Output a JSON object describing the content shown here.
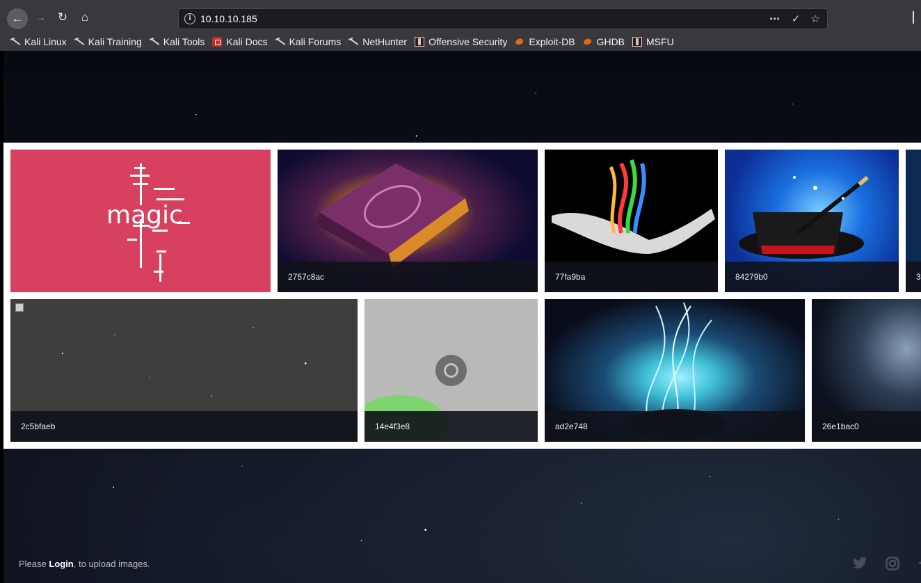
{
  "browser": {
    "url": "10.10.10.185",
    "bookmarks": [
      {
        "label": "Kali Linux",
        "icon": "kali-dragon-icon"
      },
      {
        "label": "Kali Training",
        "icon": "kali-dragon-icon"
      },
      {
        "label": "Kali Tools",
        "icon": "kali-dragon-icon"
      },
      {
        "label": "Kali Docs",
        "icon": "kali-docs-icon"
      },
      {
        "label": "Kali Forums",
        "icon": "kali-dragon-icon"
      },
      {
        "label": "NetHunter",
        "icon": "kali-dragon-icon"
      },
      {
        "label": "Offensive Security",
        "icon": "offsec-icon"
      },
      {
        "label": "Exploit-DB",
        "icon": "exploitdb-icon"
      },
      {
        "label": "GHDB",
        "icon": "ghdb-icon"
      },
      {
        "label": "MSFU",
        "icon": "msfu-icon"
      }
    ]
  },
  "gallery": {
    "row1": [
      {
        "caption": ""
      },
      {
        "caption": "2757c8ac"
      },
      {
        "caption": "77fa9ba"
      },
      {
        "caption": "84279b0"
      },
      {
        "caption": "3"
      }
    ],
    "row2": [
      {
        "caption": "2c5bfaeb"
      },
      {
        "caption": "14e4f3e8"
      },
      {
        "caption": "ad2e748"
      },
      {
        "caption": "26e1bac0"
      }
    ]
  },
  "magic_word": "magic",
  "footer": {
    "prefix": "Please ",
    "login_label": "Login",
    "suffix": ", to upload images.",
    "social": [
      "twitter-icon",
      "instagram-icon",
      "facebook-icon"
    ]
  },
  "colors": {
    "magic_tile": "#d7405f",
    "caption_bar": "#10121a",
    "toolbar": "#38383d"
  }
}
